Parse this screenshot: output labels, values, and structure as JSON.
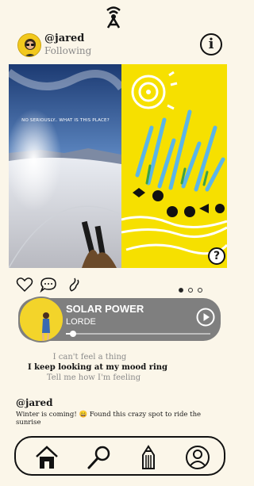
{
  "app": {
    "logo_icon": "tower-broadcast-icon"
  },
  "post": {
    "author": "@jared",
    "status": "Following",
    "overlay_text": "NO SERIOUSLY.. WHAT IS THIS PLACE?",
    "caption_author": "@jared",
    "caption": "Winter is coming! 😄 Found this crazy spot to ride the sunrise",
    "carousel": {
      "count": 3,
      "active": 1
    }
  },
  "music": {
    "song": "SOLAR POWER",
    "artist": "LORDE",
    "progress": 0.05
  },
  "lyrics": [
    {
      "text": "I can't feel a thing",
      "current": false
    },
    {
      "text": "I keep looking at my mood ring",
      "current": true
    },
    {
      "text": "Tell me how I'm feeling",
      "current": false
    }
  ],
  "colors": {
    "background": "#fbf6e9",
    "accent_yellow": "#f6e000",
    "player_gray": "#7f7f7f"
  }
}
